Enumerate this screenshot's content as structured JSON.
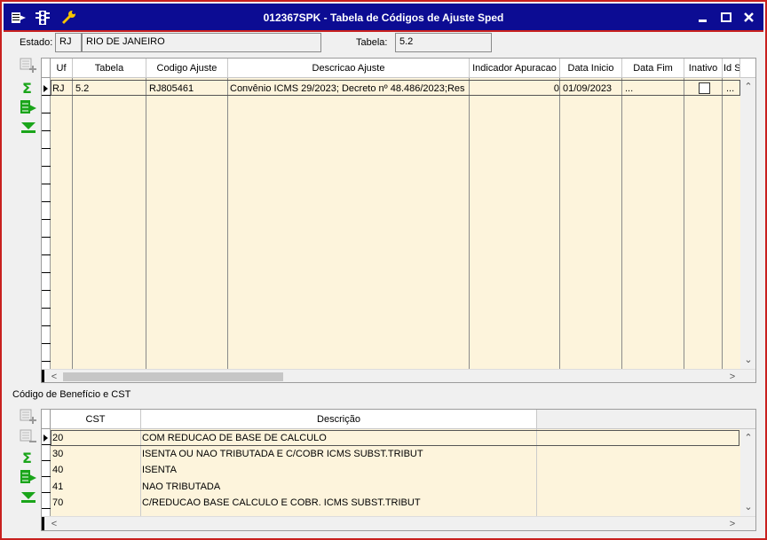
{
  "window": {
    "title": "012367SPK - Tabela de Códigos de Ajuste Sped"
  },
  "header": {
    "estado_label": "Estado:",
    "estado_code": "RJ",
    "estado_name": "RIO DE JANEIRO",
    "tabela_label": "Tabela:",
    "tabela_value": "5.2"
  },
  "grid1": {
    "columns": [
      "Uf",
      "Tabela",
      "Codigo Ajuste",
      "Descricao Ajuste",
      "Indicador Apuracao",
      "Data Inicio",
      "Data Fim",
      "Inativo",
      "Id S"
    ],
    "rows": [
      {
        "uf": "RJ",
        "tabela": "5.2",
        "codigo": "RJ805461",
        "descricao": "Convênio ICMS 29/2023; Decreto nº 48.486/2023;Res",
        "indicador": "0",
        "data_inicio": "01/09/2023",
        "data_fim": "...",
        "inativo": false,
        "id": "..."
      }
    ]
  },
  "section2": {
    "title": "Código de Benefício e CST"
  },
  "grid2": {
    "columns": [
      "CST",
      "Descrição"
    ],
    "rows": [
      {
        "cst": "20",
        "descricao": "COM REDUCAO DE BASE DE CALCULO"
      },
      {
        "cst": "30",
        "descricao": "ISENTA OU NAO TRIBUTADA E C/COBR ICMS SUBST.TRIBUT"
      },
      {
        "cst": "40",
        "descricao": "ISENTA"
      },
      {
        "cst": "41",
        "descricao": "NAO TRIBUTADA"
      },
      {
        "cst": "70",
        "descricao": "C/REDUCAO BASE CALCULO E COBR. ICMS SUBST.TRIBUT"
      }
    ]
  },
  "colors": {
    "titlebar": "#0c0c93",
    "border": "#c8201e",
    "grid_bg": "#fdf4dc",
    "icon_green": "#1aa51a"
  }
}
